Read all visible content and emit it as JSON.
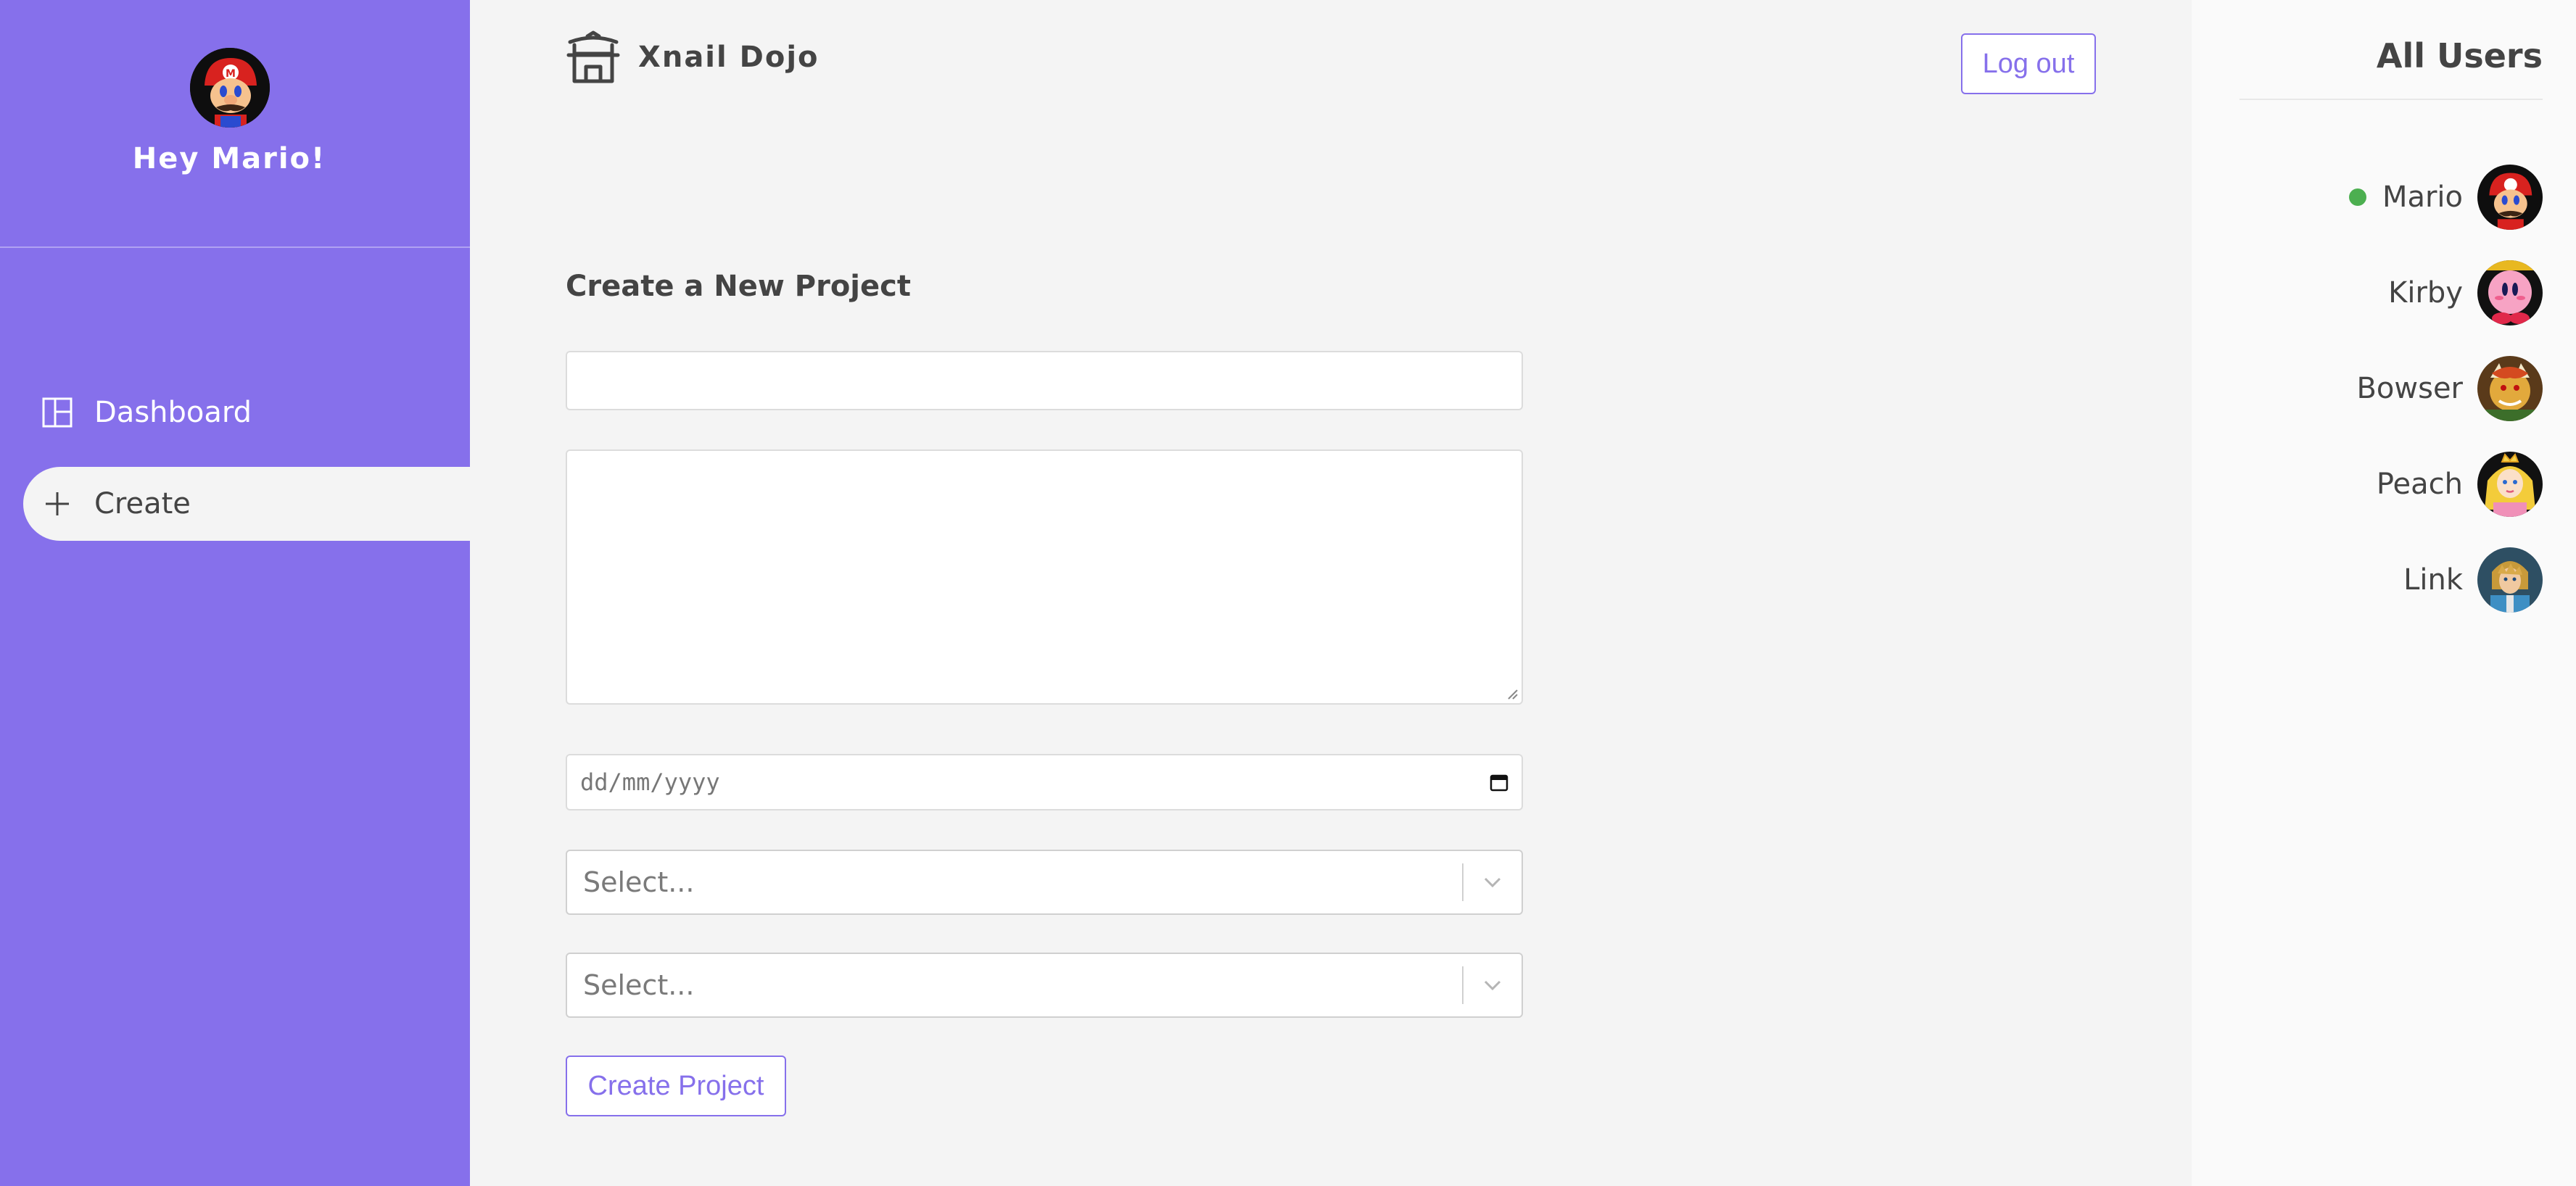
{
  "sidebar": {
    "avatar_icon": "mario-avatar",
    "greeting": "Hey Mario!",
    "nav": [
      {
        "label": "Dashboard",
        "icon": "dashboard-icon",
        "active": false
      },
      {
        "label": "Create",
        "icon": "plus-icon",
        "active": true
      }
    ]
  },
  "header": {
    "brand": "Xnail Dojo",
    "logo_icon": "dojo-temple-icon",
    "logout_label": "Log out"
  },
  "form": {
    "title": "Create a New Project",
    "name_value": "",
    "details_value": "",
    "date_placeholder": "dd/mm/yyyy",
    "category_placeholder": "Select...",
    "assign_placeholder": "Select...",
    "submit_label": "Create Project"
  },
  "users_panel": {
    "title": "All Users",
    "users": [
      {
        "name": "Mario",
        "online": true,
        "avatar": "mario-avatar"
      },
      {
        "name": "Kirby",
        "online": false,
        "avatar": "kirby-avatar"
      },
      {
        "name": "Bowser",
        "online": false,
        "avatar": "bowser-avatar"
      },
      {
        "name": "Peach",
        "online": false,
        "avatar": "peach-avatar"
      },
      {
        "name": "Link",
        "online": false,
        "avatar": "link-avatar"
      }
    ]
  },
  "colors": {
    "accent": "#8670eb",
    "background": "#f4f4f4",
    "online": "#4caf50"
  }
}
